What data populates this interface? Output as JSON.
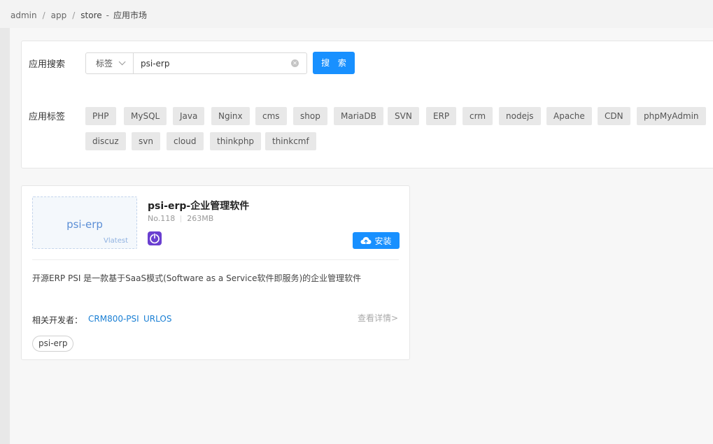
{
  "breadcrumb": {
    "items": [
      "admin",
      "app",
      "store"
    ],
    "separator": "/",
    "dash": "-",
    "current": "应用市场"
  },
  "search": {
    "label": "应用搜索",
    "type_value": "标签",
    "input_value": "psi-erp",
    "button_label": "搜 索"
  },
  "tags": {
    "label": "应用标签",
    "items": [
      "PHP",
      "MySQL",
      "Java",
      "Nginx",
      "cms",
      "shop",
      "MariaDB",
      "SVN",
      "ERP",
      "crm",
      "nodejs",
      "Apache",
      "CDN",
      "phpMyAdmin",
      "discuz",
      "svn",
      "cloud",
      "thinkphp",
      "thinkcmf"
    ]
  },
  "app": {
    "thumb_name": "psi-erp",
    "thumb_version": "Vlatest",
    "title": "psi-erp-企业管理软件",
    "number": "No.118",
    "size": "263MB",
    "install_label": "安装",
    "description": "开源ERP PSI 是一款基于SaaS模式(Software as a Service软件即服务)的企业管理软件",
    "developers_label": "相关开发者：",
    "developers": [
      "CRM800-PSI",
      "URLOS"
    ],
    "detail_link": "查看详情>",
    "tag": "psi-erp"
  },
  "colors": {
    "primary": "#1890ff",
    "link": "#1a7fd4",
    "icon_purple": "#6a3fd0",
    "tag_bg": "#e8e8e8"
  },
  "icons": [
    "clear-icon",
    "chevron-down-icon",
    "power-icon",
    "cloud-upload-icon"
  ]
}
